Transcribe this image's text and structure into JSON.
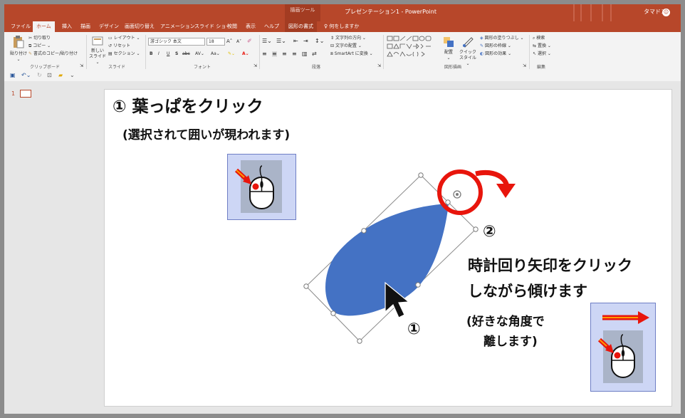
{
  "titlebar": {
    "context_tab_group": "描画ツール",
    "document_title": "プレゼンテーション1 - PowerPoint",
    "user_name": "タマドコ",
    "avatar_glyph": "☺"
  },
  "tabs": [
    {
      "label": "ファイル",
      "active": false
    },
    {
      "label": "ホーム",
      "active": true
    },
    {
      "label": "挿入",
      "active": false
    },
    {
      "label": "描画",
      "active": false
    },
    {
      "label": "デザイン",
      "active": false
    },
    {
      "label": "画面切り替え",
      "active": false
    },
    {
      "label": "アニメーション",
      "active": false
    },
    {
      "label": "スライド ショー",
      "active": false
    },
    {
      "label": "校閲",
      "active": false
    },
    {
      "label": "表示",
      "active": false
    },
    {
      "label": "ヘルプ",
      "active": false
    },
    {
      "label": "図形の書式",
      "active": false
    }
  ],
  "tell_me": "何をしますか",
  "ribbon": {
    "clipboard": {
      "paste": "貼り付け",
      "cut": "切り取り",
      "copy": "コピー",
      "format_painter": "書式のコピー/貼り付け",
      "group_label": "クリップボード"
    },
    "slides": {
      "new_slide_line1": "新しい",
      "new_slide_line2": "スライド",
      "layout": "レイアウト",
      "reset": "リセット",
      "section": "セクション",
      "group_label": "スライド"
    },
    "font": {
      "font_name": "游ゴシック 本文",
      "font_size": "18",
      "group_label": "フォント",
      "bold": "B",
      "italic": "I",
      "underline": "U",
      "shadow": "S",
      "strike": "abc",
      "spacing": "AV",
      "case": "Aa",
      "grow": "A",
      "shrink": "A"
    },
    "paragraph": {
      "text_direction": "文字列の方向",
      "align_text": "文字の配置",
      "smartart": "SmartArt に変換",
      "group_label": "段落"
    },
    "drawing": {
      "arrange": "配置",
      "quick_styles_line1": "クイック",
      "quick_styles_line2": "スタイル",
      "shape_fill": "図形の塗りつぶし",
      "shape_outline": "図形の枠線",
      "shape_effects": "図形の効果",
      "group_label": "図形描画"
    },
    "editing": {
      "find": "検索",
      "replace": "置換",
      "select": "選択",
      "group_label": "編集"
    }
  },
  "thumbnail_panel": {
    "slide_number": "1"
  },
  "slide": {
    "step1_title": "① 葉っぱをクリック",
    "step1_sub": "(選択されて囲いが現われます)",
    "step2_number": "②",
    "step2_line1": "時計回り矢印をクリック",
    "step2_line2": "しながら傾けます",
    "step2_note_line1": "(好きな角度で",
    "step2_note_line2": "離します)",
    "cursor_number": "①"
  },
  "colors": {
    "accent": "#b7472a",
    "leaf_fill": "#4472c4",
    "annotation_red": "#e8150c",
    "arrow_orange": "#ff8c00"
  }
}
